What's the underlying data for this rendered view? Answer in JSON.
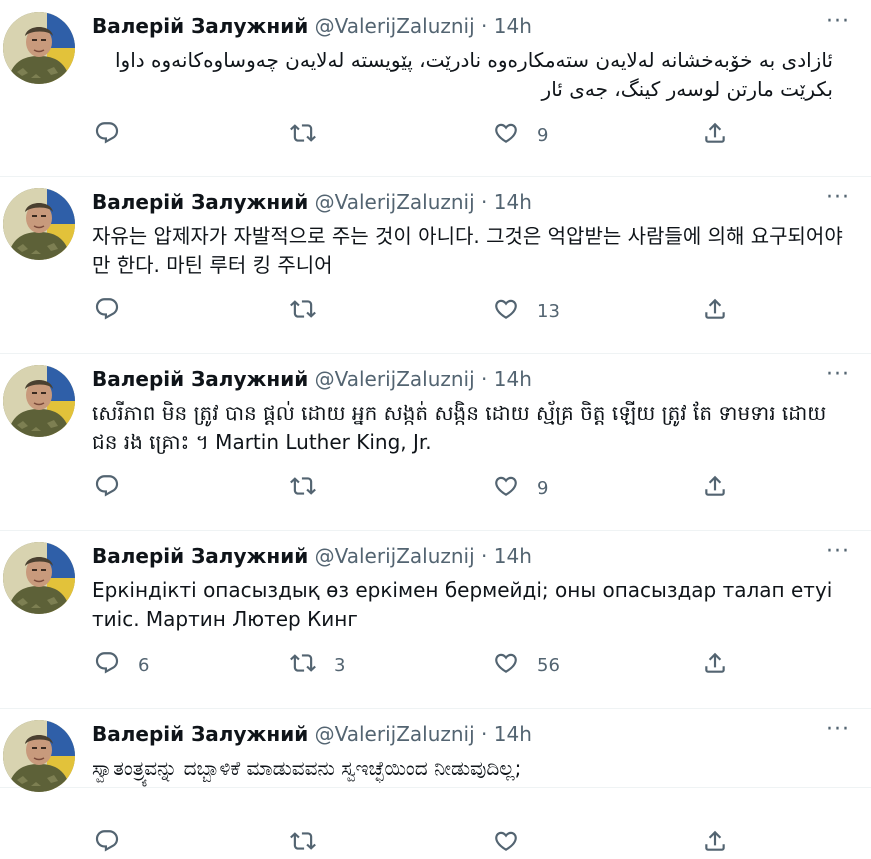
{
  "tweets": [
    {
      "name": "Валерій Залужний",
      "handle": "@ValerijZaluznij",
      "time": "· 14h",
      "text": "ئازادی بە خۆبەخشانە لەلایەن ستەمکارەوە نادرێت، پێویستە لەلایەن چەوساوەکانەوە داوا بکرێت مارتن لوسەر کینگ، جەی ئار",
      "rtl": true,
      "reply_count": "",
      "retweet_count": "",
      "like_count": "9"
    },
    {
      "name": "Валерій Залужний",
      "handle": "@ValerijZaluznij",
      "time": "· 14h",
      "text": "자유는 압제자가 자발적으로 주는 것이 아니다. 그것은 억압받는 사람들에 의해 요구되어야만 한다. 마틴 루터 킹 주니어",
      "rtl": false,
      "reply_count": "",
      "retweet_count": "",
      "like_count": "13"
    },
    {
      "name": "Валерій Залужний",
      "handle": "@ValerijZaluznij",
      "time": "· 14h",
      "text": "សេរីភាព មិន ត្រូវ បាន ផ្តល់ ដោយ អ្នក សង្កត់ សង្កិន ដោយ ស្ម័គ្រ ចិត្ត ឡើយ ត្រូវ តែ ទាមទារ ដោយ ជន រង គ្រោះ ។ Martin Luther King, Jr.",
      "rtl": false,
      "reply_count": "",
      "retweet_count": "",
      "like_count": "9"
    },
    {
      "name": "Валерій Залужний",
      "handle": "@ValerijZaluznij",
      "time": "· 14h",
      "text": "Еркіндікті опасыздық өз еркімен бермейді; оны опасыздар талап етуі тиіс. Мартин Лютер Кинг",
      "rtl": false,
      "reply_count": "6",
      "retweet_count": "3",
      "like_count": "56"
    },
    {
      "name": "Валерій Залужний",
      "handle": "@ValerijZaluznij",
      "time": "· 14h",
      "text": "ಸ್ವಾತಂತ್ರ್ಯವನ್ನು ದಬ್ಬಾಳಿಕೆ ಮಾಡುವವನು ಸ್ವಇಚ್ಛೆಯಿಂದ ನೀಡುವುದಿಲ್ಲ;",
      "rtl": false,
      "reply_count": "",
      "retweet_count": "",
      "like_count": ""
    }
  ],
  "icons": {
    "more": "more-dots-icon",
    "reply": "reply-icon",
    "retweet": "retweet-icon",
    "like": "heart-icon",
    "share": "share-icon"
  },
  "colors": {
    "text": "#0f1419",
    "secondary": "#536471",
    "divider": "#eff3f4"
  }
}
